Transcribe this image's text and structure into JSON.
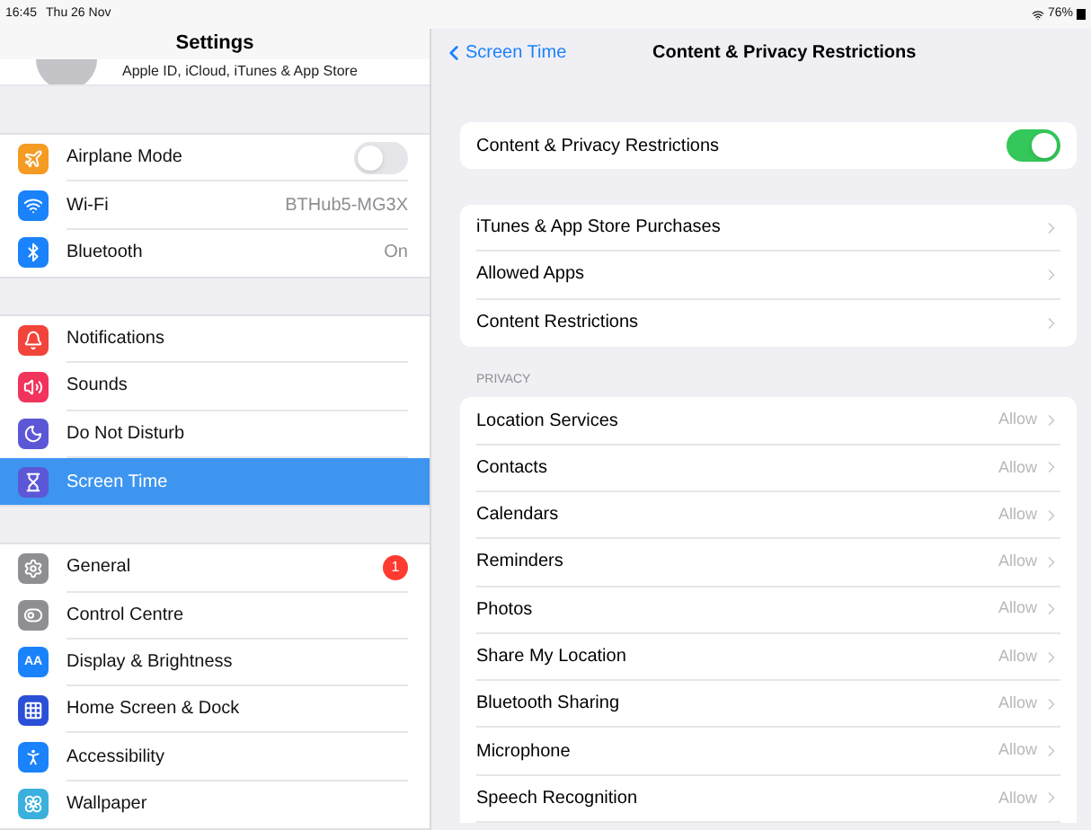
{
  "status_bar": {
    "time": "16:45",
    "date": "Thu 26 Nov",
    "battery": "76%"
  },
  "sidebar": {
    "title": "Settings",
    "account_subtitle": "Apple ID, iCloud, iTunes & App Store",
    "groups": [
      [
        {
          "label": "Airplane Mode",
          "kind": "toggle",
          "on": false,
          "selected": false
        },
        {
          "label": "Wi-Fi",
          "kind": "value",
          "value": "BTHub5-MG3X",
          "selected": false
        },
        {
          "label": "Bluetooth",
          "kind": "value",
          "value": "On",
          "selected": false
        }
      ],
      [
        {
          "label": "Notifications",
          "kind": "plain",
          "selected": false
        },
        {
          "label": "Sounds",
          "kind": "plain",
          "selected": false
        },
        {
          "label": "Do Not Disturb",
          "kind": "plain",
          "selected": false
        },
        {
          "label": "Screen Time",
          "kind": "plain",
          "selected": true
        }
      ],
      [
        {
          "label": "General",
          "kind": "badge",
          "badge": "1",
          "selected": false
        },
        {
          "label": "Control Centre",
          "kind": "plain",
          "selected": false
        },
        {
          "label": "Display & Brightness",
          "kind": "plain",
          "icon_text": "AA",
          "selected": false
        },
        {
          "label": "Home Screen & Dock",
          "kind": "plain",
          "selected": false
        },
        {
          "label": "Accessibility",
          "kind": "plain",
          "selected": false
        },
        {
          "label": "Wallpaper",
          "kind": "plain",
          "selected": false
        }
      ]
    ]
  },
  "detail": {
    "back": "Screen Time",
    "title": "Content & Privacy Restrictions",
    "master": {
      "label": "Content & Privacy Restrictions",
      "on": true
    },
    "links": [
      "iTunes & App Store Purchases",
      "Allowed Apps",
      "Content Restrictions"
    ],
    "privacy_header": "PRIVACY",
    "privacy": [
      {
        "label": "Location Services",
        "value": "Allow"
      },
      {
        "label": "Contacts",
        "value": "Allow"
      },
      {
        "label": "Calendars",
        "value": "Allow"
      },
      {
        "label": "Reminders",
        "value": "Allow"
      },
      {
        "label": "Photos",
        "value": "Allow"
      },
      {
        "label": "Share My Location",
        "value": "Allow"
      },
      {
        "label": "Bluetooth Sharing",
        "value": "Allow"
      },
      {
        "label": "Microphone",
        "value": "Allow"
      },
      {
        "label": "Speech Recognition",
        "value": "Allow"
      }
    ]
  }
}
